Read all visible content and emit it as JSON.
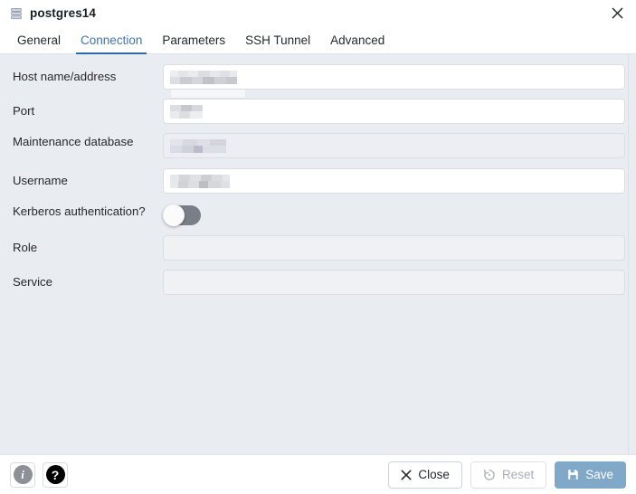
{
  "window": {
    "title": "postgres14",
    "icon": "server-stack-icon",
    "close_icon": "close-icon"
  },
  "tabs": [
    {
      "label": "General",
      "active": false
    },
    {
      "label": "Connection",
      "active": true
    },
    {
      "label": "Parameters",
      "active": false
    },
    {
      "label": "SSH Tunnel",
      "active": false
    },
    {
      "label": "Advanced",
      "active": false
    }
  ],
  "form": {
    "fields": [
      {
        "label": "Host name/address",
        "value": "",
        "value_state": "redacted",
        "input_state": "filled-white",
        "type": "text"
      },
      {
        "label": "Port",
        "value": "",
        "value_state": "redacted",
        "input_state": "filled-white",
        "type": "text"
      },
      {
        "label": "Maintenance database",
        "value": "",
        "value_state": "redacted",
        "input_state": "filled-grey",
        "type": "text"
      },
      {
        "label": "Username",
        "value": "",
        "value_state": "redacted",
        "input_state": "filled-white",
        "type": "text"
      },
      {
        "label": "Kerberos authentication?",
        "value": "off",
        "input_state": "toggle",
        "type": "toggle"
      },
      {
        "label": "Role",
        "value": "",
        "value_state": "empty",
        "input_state": "empty",
        "type": "text"
      },
      {
        "label": "Service",
        "value": "",
        "value_state": "empty",
        "input_state": "empty",
        "type": "text"
      }
    ]
  },
  "footer": {
    "info_label": "i",
    "info_icon": "info-icon",
    "help_label": "?",
    "help_icon": "help-icon",
    "close_label": "Close",
    "close_icon": "close-x-icon",
    "reset_label": "Reset",
    "reset_icon": "reset-undo-icon",
    "save_label": "Save",
    "save_icon": "save-floppy-icon"
  },
  "colors": {
    "body_background": "#e9ecf1",
    "accent_tab": "#4175ab",
    "tab_underline": "#2d6ca2",
    "save_button": "#7fa8c9",
    "toggle_track": "#7a7f87"
  }
}
